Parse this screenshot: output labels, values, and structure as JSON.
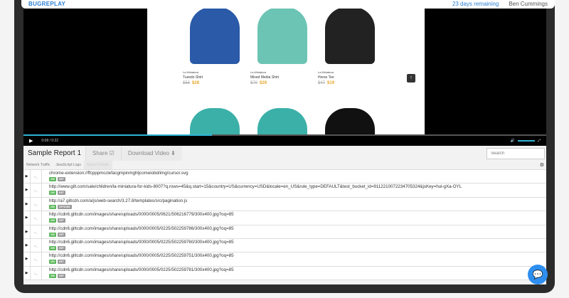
{
  "topbar": {
    "logo": "BUGREPLAY",
    "trial": "23 days remaining",
    "user": "Ben Cummings"
  },
  "products": [
    {
      "brand": "La Miniatura",
      "name": "Tuxedo Shirt",
      "old_price": "$56",
      "price": "$28",
      "color": "#2a5aa8"
    },
    {
      "brand": "La Miniatura",
      "name": "Mixed Media Shirt",
      "old_price": "$70",
      "price": "$29",
      "color": "#6cc4b4"
    },
    {
      "brand": "La Miniatura",
      "name": "Horse Tee",
      "old_price": "$47",
      "price": "$19",
      "color": "#222222"
    }
  ],
  "player": {
    "current": "0:08",
    "duration": "0:22",
    "progress": 0.36
  },
  "report": {
    "title": "Sample Report 1",
    "share": "Share",
    "download": "Download Video",
    "search_placeholder": "Search"
  },
  "tabs": [
    "Network Traffic",
    "JavaScript Logs",
    "Report Details"
  ],
  "requests": [
    {
      "url": "chrome-extension://ffcpppmcclefacgmpinmghljcomeiobd/img/cursor.svg",
      "status": "200",
      "method": "GET"
    },
    {
      "url": "http://www.gilt.com/sale/children/la-miniatura-for-kids-8007?q.rows=45&q.start=15&country=US&currency=USD&locale=en_US&rule_type=DEFAULT&test_bucket_id=911221007223470532​4&jsKey=hul-gXa-OYL",
      "status": "200",
      "method": "GET"
    },
    {
      "url": "http://a7.giltcdn.com/a/js/web-search/3.27.8/templates/src/pagination.js",
      "status": "200",
      "method": "OPTIONS"
    },
    {
      "url": "http://cdn6.giltcdn.com/images/share/uploads/0000/0005/0621/506216779/300x400.jpg?oq=85",
      "status": "200",
      "method": "GET"
    },
    {
      "url": "http://cdn6.giltcdn.com/images/share/uploads/0000/0005/0225/502259786/300x400.jpg?oq=85",
      "status": "200",
      "method": "GET"
    },
    {
      "url": "http://cdn6.giltcdn.com/images/share/uploads/0000/0005/0225/502259760/300x400.jpg?oq=85",
      "status": "200",
      "method": "GET"
    },
    {
      "url": "http://cdn6.giltcdn.com/images/share/uploads/0000/0005/0225/502259751/300x400.jpg?oq=85",
      "status": "200",
      "method": "GET"
    },
    {
      "url": "http://cdn6.giltcdn.com/images/share/uploads/0000/0005/0225/502259781/300x400.jpg?oq=85",
      "status": "200",
      "method": "GET"
    }
  ]
}
